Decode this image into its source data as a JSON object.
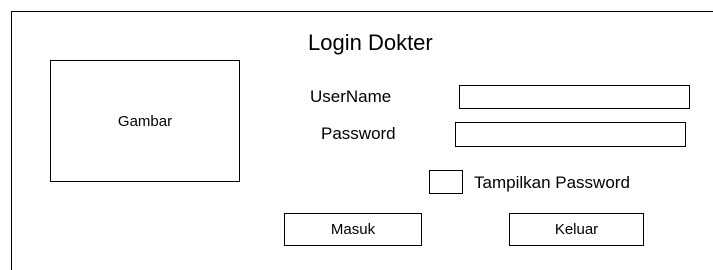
{
  "form": {
    "title": "Login Dokter",
    "image_placeholder": "Gambar",
    "username_label": "UserName",
    "username_value": "",
    "password_label": "Password",
    "password_value": "",
    "show_password_label": "Tampilkan Password",
    "show_password_checked": false,
    "login_button": "Masuk",
    "exit_button": "Keluar"
  }
}
